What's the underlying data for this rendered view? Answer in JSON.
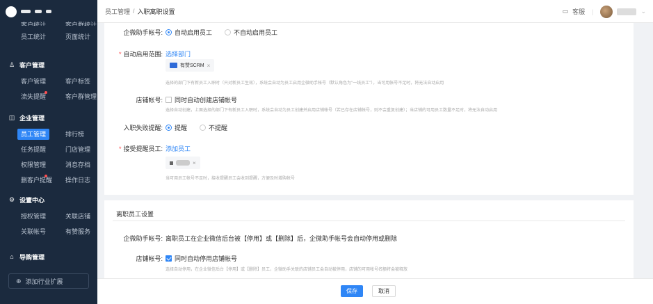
{
  "sidebar": {
    "top_row": [
      "客户统计",
      "客户群统计"
    ],
    "row_stats": [
      "员工统计",
      "页面统计"
    ],
    "section_customer": "客户管理",
    "customer_items": [
      [
        "客户管理",
        "客户标签"
      ],
      [
        "流失提醒",
        "客户群管理"
      ]
    ],
    "section_enterprise": "企业管理",
    "enterprise_items": [
      [
        "员工管理",
        "排行榜"
      ],
      [
        "任务提醒",
        "门店管理"
      ],
      [
        "权限管理",
        "消息存档"
      ],
      [
        "删客户提醒",
        "操作日志"
      ]
    ],
    "section_settings": "设置中心",
    "settings_items": [
      [
        "授权管理",
        "关联店铺"
      ],
      [
        "关联帐号",
        "有赞服务"
      ]
    ],
    "section_guide": "导购管理",
    "add_ext": "添加行业扩展"
  },
  "header": {
    "crumb_root": "员工管理",
    "crumb_sep": "/",
    "crumb_current": "入职离职设置",
    "service": "客服",
    "divider": "|"
  },
  "onboard": {
    "wecom_label": "企微助手帐号:",
    "wecom_opt_on": "自动启用员工",
    "wecom_opt_off": "不自动启用员工",
    "scope_label": "自动启用范围:",
    "scope_link": "选择部门",
    "scope_tag": "有赞SCRM",
    "tag_close": "×",
    "scope_hint": "选择的部门下有新员工入职时（只对新员工生效），系统会自动为员工启用企微助手帐号（默认角色为\"一线员工\"），当可用帐号不足时，将无法自动启用",
    "store_label": "店铺帐号:",
    "store_check": "同时自动创建店铺帐号",
    "store_hint": "选择自动创建，上面选择的部门下有新员工入职时，系统会自动为员工创建并启用店铺帐号（若已存在店铺帐号，则不会重复创建）；当店铺的可用员工数量不足时，将无法自动启用",
    "fail_label": "入职失败提醒:",
    "fail_opt_on": "提醒",
    "fail_opt_off": "不提醒",
    "recv_label": "接受提醒员工:",
    "recv_link": "添加员工",
    "recv_hint": "当可用员工帐号不足时，接收提醒员工会收到提醒，方便及时增购帐号"
  },
  "offboard": {
    "title": "离职员工设置",
    "wecom_label": "企微助手帐号:",
    "wecom_text": "离职员工在企业微信后台被【停用】或【删除】后，企微助手帐号会自动停用或删除",
    "store_label": "店铺帐号:",
    "store_check": "同时自动停用店铺帐号",
    "store_hint": "选择自动停用，在企业微信后台【停用】或【删除】员工，企微助手关联的店铺员工会自动被停用，店铺的可用帐号名额将会被释放"
  },
  "footer": {
    "save": "保存",
    "cancel": "取消"
  },
  "colors": {
    "accent": "#2f86f6",
    "sidebar_bg": "#1b2a3e",
    "required": "#ff4d4f"
  }
}
